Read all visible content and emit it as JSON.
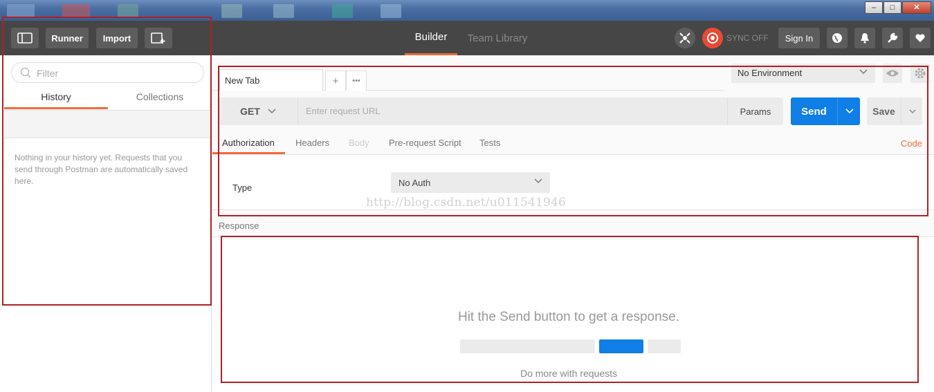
{
  "header": {
    "runner_label": "Runner",
    "import_label": "Import",
    "tabs": [
      {
        "label": "Builder",
        "active": true
      },
      {
        "label": "Team Library",
        "active": false
      }
    ],
    "sync_label": "SYNC OFF",
    "signin_label": "Sign In"
  },
  "sidebar": {
    "filter_placeholder": "Filter",
    "tabs": [
      {
        "label": "History",
        "active": true
      },
      {
        "label": "Collections",
        "active": false
      }
    ],
    "empty_message": "Nothing in your history yet. Requests that you send through Postman are automatically saved here."
  },
  "main": {
    "tab_label": "New Tab",
    "add_tab": "+",
    "more_tabs": "•••",
    "environment": "No Environment",
    "method": "GET",
    "url_placeholder": "Enter request URL",
    "params_label": "Params",
    "send_label": "Send",
    "save_label": "Save",
    "request_tabs": [
      {
        "label": "Authorization",
        "state": "active"
      },
      {
        "label": "Headers",
        "state": "inactive"
      },
      {
        "label": "Body",
        "state": "disabled"
      },
      {
        "label": "Pre-request Script",
        "state": "inactive"
      },
      {
        "label": "Tests",
        "state": "inactive"
      }
    ],
    "code_label": "Code",
    "auth_type_label": "Type",
    "auth_type_value": "No Auth",
    "watermark": "http://blog.csdn.net/u011541946",
    "response_label": "Response",
    "response_hint": "Hit the Send button to get a response.",
    "do_more": "Do more with requests"
  },
  "colors": {
    "accent": "#f26b3a",
    "send_blue": "#0f7ee6",
    "header_bg": "#464646",
    "annotation_red": "#b21f24"
  },
  "icons": [
    "sidebar-toggle-icon",
    "new-window-icon",
    "interceptor-icon",
    "sync-icon",
    "globe-icon",
    "bell-icon",
    "wrench-icon",
    "heart-icon",
    "search-icon",
    "eye-icon",
    "gear-icon",
    "chevron-down-icon"
  ]
}
